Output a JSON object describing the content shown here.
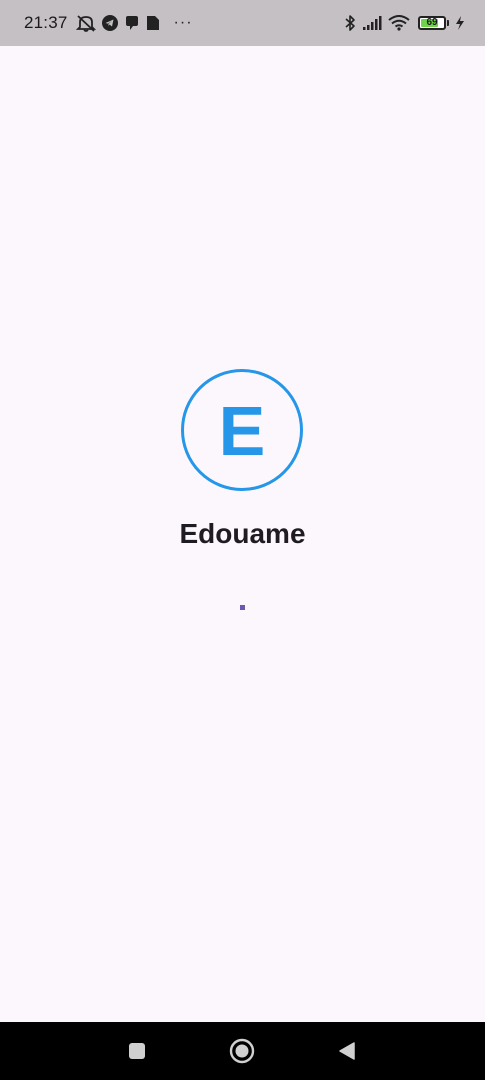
{
  "status_bar": {
    "time": "21:37",
    "battery_level": "69",
    "battery_fraction": 0.69,
    "icons": [
      "mute-icon",
      "telegram-icon",
      "chat-icon",
      "sim-icon",
      "more-dots-icon",
      "bluetooth-icon",
      "signal-icon",
      "wifi-icon",
      "battery-icon",
      "charging-icon"
    ],
    "more": "···"
  },
  "splash": {
    "logo_letter": "E",
    "app_name": "Edouame",
    "accent_color": "#2596e8",
    "loader_color": "#6a58b5"
  },
  "nav_bar": {
    "buttons": [
      "recents-button",
      "home-button",
      "back-button"
    ]
  }
}
